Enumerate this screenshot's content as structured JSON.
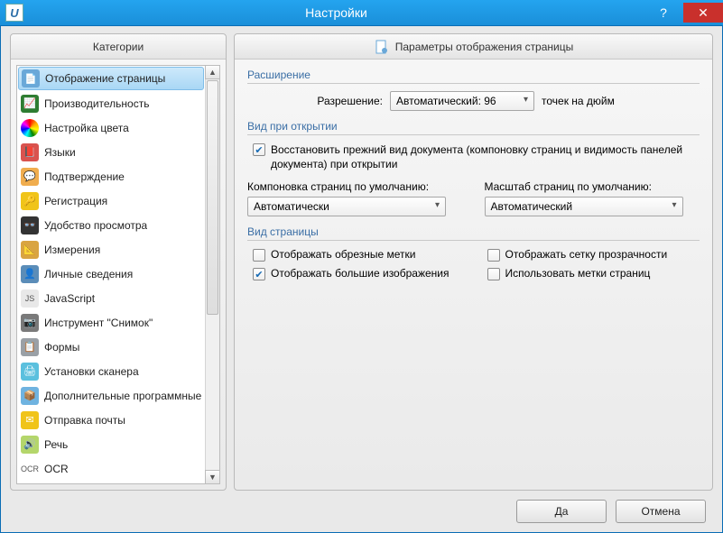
{
  "window": {
    "title": "Настройки"
  },
  "left_panel": {
    "title": "Категории"
  },
  "right_panel": {
    "title": "Параметры отображения страницы"
  },
  "categories": [
    {
      "label": "Отображение страницы",
      "icon": "page-icon",
      "color": "#6aa8d8",
      "selected": true
    },
    {
      "label": "Производительность",
      "icon": "perf-icon",
      "color": "#2e7d32"
    },
    {
      "label": "Настройка цвета",
      "icon": "color-icon",
      "color": ""
    },
    {
      "label": "Языки",
      "icon": "lang-icon",
      "color": "#d9534f"
    },
    {
      "label": "Подтверждение",
      "icon": "confirm-icon",
      "color": "#f0ad4e"
    },
    {
      "label": "Регистрация",
      "icon": "reg-icon",
      "color": "#f0c419"
    },
    {
      "label": "Удобство просмотра",
      "icon": "glasses-icon",
      "color": "#333"
    },
    {
      "label": "Измерения",
      "icon": "measure-icon",
      "color": "#d9a441"
    },
    {
      "label": "Личные сведения",
      "icon": "identity-icon",
      "color": "#5b8db8"
    },
    {
      "label": "JavaScript",
      "icon": "js-icon",
      "color": "#9aa0a6"
    },
    {
      "label": "Инструмент \"Снимок\"",
      "icon": "snapshot-icon",
      "color": "#7a7a7a"
    },
    {
      "label": "Формы",
      "icon": "forms-icon",
      "color": "#9aa0a6"
    },
    {
      "label": "Установки сканера",
      "icon": "scanner-icon",
      "color": "#5bc0de"
    },
    {
      "label": "Дополнительные программные модули",
      "icon": "plugins-icon",
      "color": "#6fb3e0"
    },
    {
      "label": "Отправка почты",
      "icon": "mail-icon",
      "color": "#f0c419"
    },
    {
      "label": "Речь",
      "icon": "speech-icon",
      "color": "#b4d66b"
    },
    {
      "label": "OCR",
      "icon": "ocr-icon",
      "color": "#888"
    }
  ],
  "sections": {
    "resolution": {
      "title": "Расширение",
      "label": "Разрешение:",
      "value": "Автоматический: 96",
      "unit": "точек на дюйм"
    },
    "onopen": {
      "title": "Вид при открытии",
      "restore_label": "Восстановить прежний вид документа (компоновку страниц и видимость панелей документа) при открытии",
      "restore_checked": true,
      "layout_label": "Компоновка страниц по умолчанию:",
      "layout_value": "Автоматически",
      "zoom_label": "Масштаб страниц по умолчанию:",
      "zoom_value": "Автоматический"
    },
    "pageview": {
      "title": "Вид страницы",
      "crop_label": "Отображать обрезные метки",
      "crop_checked": false,
      "grid_label": "Отображать сетку прозрачности",
      "grid_checked": false,
      "large_label": "Отображать большие изображения",
      "large_checked": true,
      "labels_label": "Использовать метки страниц",
      "labels_checked": false
    }
  },
  "buttons": {
    "ok": "Да",
    "cancel": "Отмена"
  }
}
